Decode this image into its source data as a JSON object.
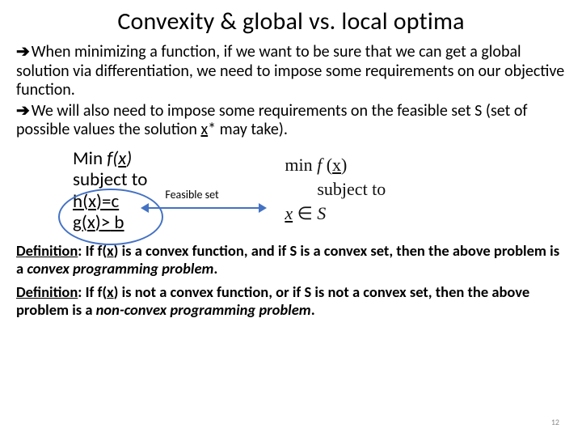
{
  "title": "Convexity & global vs. local optima",
  "para1_a": "When minimizing a function, if we want to be sure that we can get a global solution via differentiation, we need to impose some requirements on our objective function.",
  "para1_b": "We will also need to impose some requirements on the feasible set S (set of possible values the solution ",
  "para1_b_x": "x",
  "para1_b_tail": "* may take).",
  "constraints": {
    "line1_a": "Min  ",
    "line1_b": "f(",
    "line1_c": "x",
    "line1_d": ")",
    "line2": "subject to",
    "line3_a": "h(",
    "line3_b": "x",
    "line3_c": ")=c",
    "line4_a": "g(",
    "line4_b": "x",
    "line4_c": ")",
    "line4_d": ">",
    "line4_e": " b"
  },
  "connector_label": "Feasible set",
  "rightmath": {
    "line1_a": "min ",
    "line1_b": "f",
    "line1_c": " (",
    "line1_d": "x",
    "line1_e": ")",
    "line2": "subject to",
    "line3_a": "x",
    "line3_b": " ∈ ",
    "line3_c": "S"
  },
  "def1_a": "Definition",
  "def1_b": ": If f(",
  "def1_c": "x",
  "def1_d": ") is a convex function, and if S is a convex set, then the above problem is a ",
  "def1_e": "convex programming problem",
  "def1_f": ".",
  "def2_a": "Definition",
  "def2_b": ": If f(",
  "def2_c": "x",
  "def2_d": ") is not a convex function, or if S is not a convex set, then the above problem is a ",
  "def2_e": "non-convex programming problem",
  "def2_f": ".",
  "pagenum": "12"
}
